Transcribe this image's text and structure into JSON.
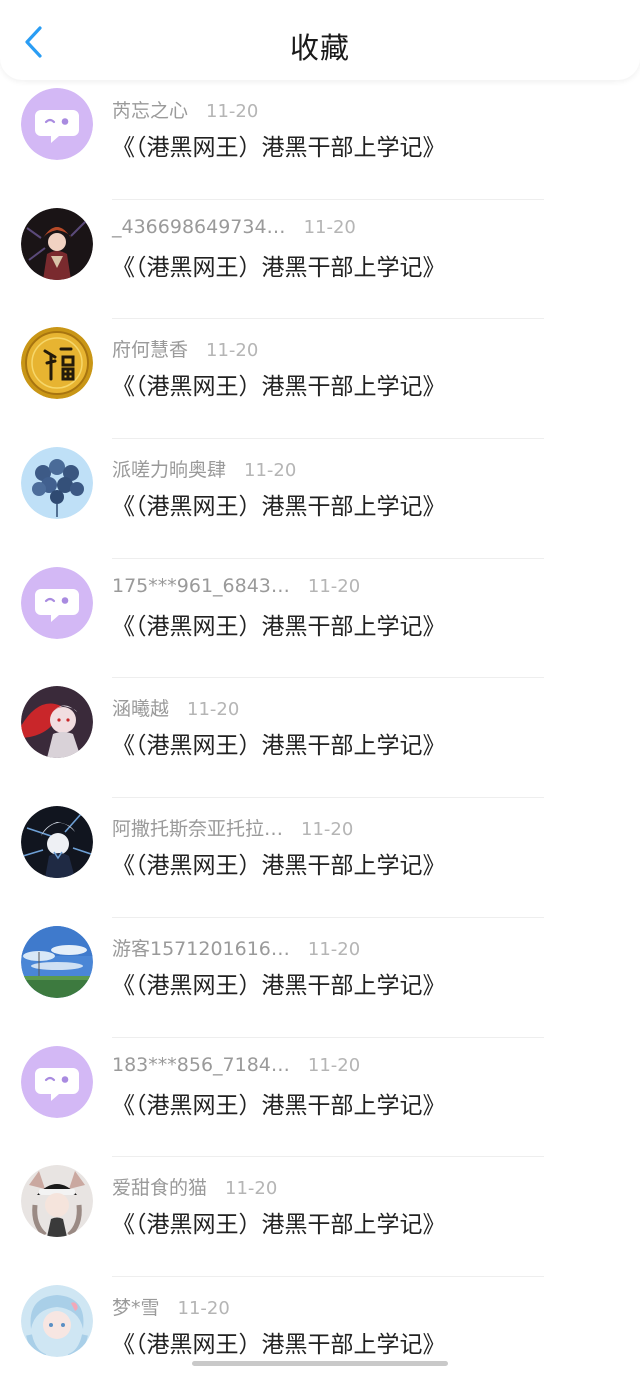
{
  "header": {
    "title": "收藏",
    "colors": {
      "back_arrow": "#2a9df4"
    }
  },
  "items": [
    {
      "name": "芮忘之心",
      "date": "11-20",
      "title": "《（港黑网王）港黑干部上学记》",
      "avatar": "default-chat-avatar"
    },
    {
      "name": "_436698649734…",
      "date": "11-20",
      "title": "《（港黑网王）港黑干部上学记》",
      "avatar": "anime-character-avatar"
    },
    {
      "name": "府何慧香",
      "date": "11-20",
      "title": "《（港黑网王）港黑干部上学记》",
      "avatar": "fu-character-avatar"
    },
    {
      "name": "派嗟力晌奥肆",
      "date": "11-20",
      "title": "《（港黑网王）港黑干部上学记》",
      "avatar": "blue-balloons-avatar"
    },
    {
      "name": "175***961_6843…",
      "date": "11-20",
      "title": "《（港黑网王）港黑干部上学记》",
      "avatar": "default-chat-avatar"
    },
    {
      "name": "涵曦越",
      "date": "11-20",
      "title": "《（港黑网王）港黑干部上学记》",
      "avatar": "anime-character-avatar"
    },
    {
      "name": "阿撒托斯奈亚托拉…",
      "date": "11-20",
      "title": "《（港黑网王）港黑干部上学记》",
      "avatar": "anime-character-avatar"
    },
    {
      "name": "游客1571201616…",
      "date": "11-20",
      "title": "《（港黑网王）港黑干部上学记》",
      "avatar": "sky-landscape-avatar"
    },
    {
      "name": "183***856_7184…",
      "date": "11-20",
      "title": "《（港黑网王）港黑干部上学记》",
      "avatar": "default-chat-avatar"
    },
    {
      "name": "爱甜食的猫",
      "date": "11-20",
      "title": "《（港黑网王）港黑干部上学记》",
      "avatar": "anime-character-avatar"
    },
    {
      "name": "梦*雪",
      "date": "11-20",
      "title": "《（港黑网王）港黑干部上学记》",
      "avatar": "anime-character-avatar"
    }
  ]
}
